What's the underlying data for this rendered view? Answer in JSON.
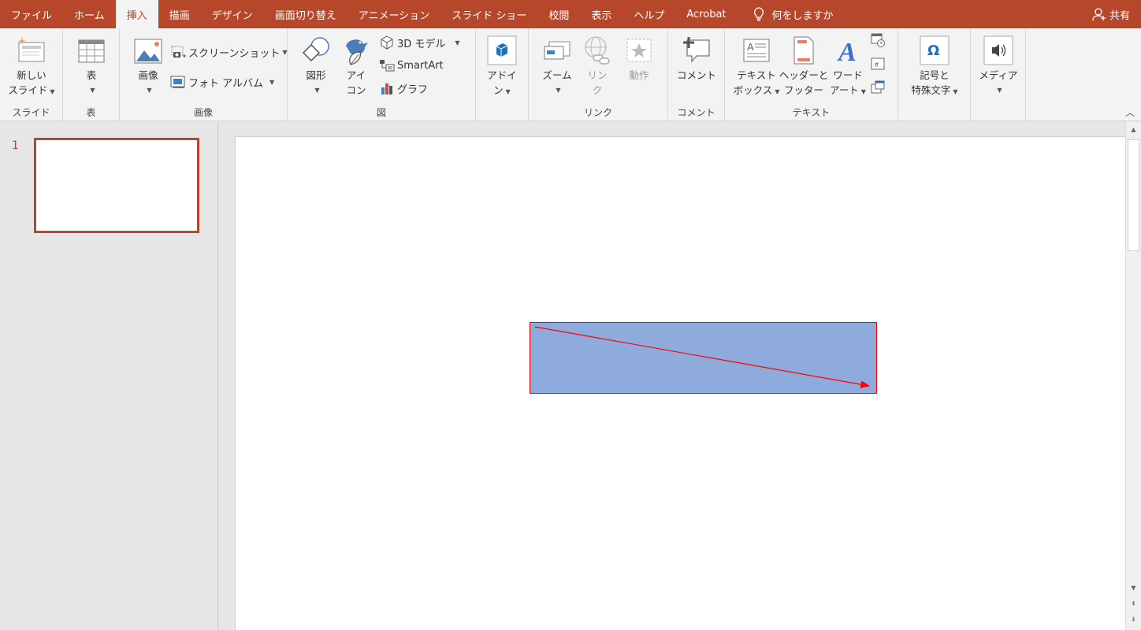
{
  "menu": {
    "tabs": [
      "ファイル",
      "ホーム",
      "挿入",
      "描画",
      "デザイン",
      "画面切り替え",
      "アニメーション",
      "スライド ショー",
      "校閲",
      "表示",
      "ヘルプ",
      "Acrobat"
    ],
    "active_tab": "挿入",
    "tell_me": "何をしますか",
    "share": "共有"
  },
  "ribbon": {
    "slides": {
      "new_slide_line1": "新しい",
      "new_slide_line2": "スライド",
      "label": "スライド"
    },
    "tables": {
      "table": "表",
      "label": "表"
    },
    "images": {
      "picture": "画像",
      "screenshot": "スクリーンショット",
      "photo_album": "フォト アルバム",
      "label": "画像"
    },
    "illustrations": {
      "shapes": "図形",
      "icons_line1": "アイ",
      "icons_line2": "コン",
      "models_3d": "3D モデル",
      "smartart": "SmartArt",
      "chart": "グラフ",
      "label": "図"
    },
    "addins": {
      "line1": "アドイ",
      "line2": "ン"
    },
    "links": {
      "zoom": "ズーム",
      "link_line1": "リン",
      "link_line2": "ク",
      "action": "動作",
      "label": "リンク"
    },
    "comments": {
      "comment": "コメント",
      "label": "コメント"
    },
    "text": {
      "textbox_line1": "テキスト",
      "textbox_line2": "ボックス",
      "header_line1": "ヘッダーと",
      "header_line2": "フッター",
      "wordart_line1": "ワード",
      "wordart_line2": "アート",
      "label": "テキスト"
    },
    "symbols": {
      "line1": "記号と",
      "line2": "特殊文字"
    },
    "media": {
      "media": "メディア"
    }
  },
  "thumbnails": {
    "slide_number": "1"
  },
  "colors": {
    "accent": "#b7472a",
    "shape_fill": "#8faadc",
    "shape_border": "#ff0000"
  }
}
